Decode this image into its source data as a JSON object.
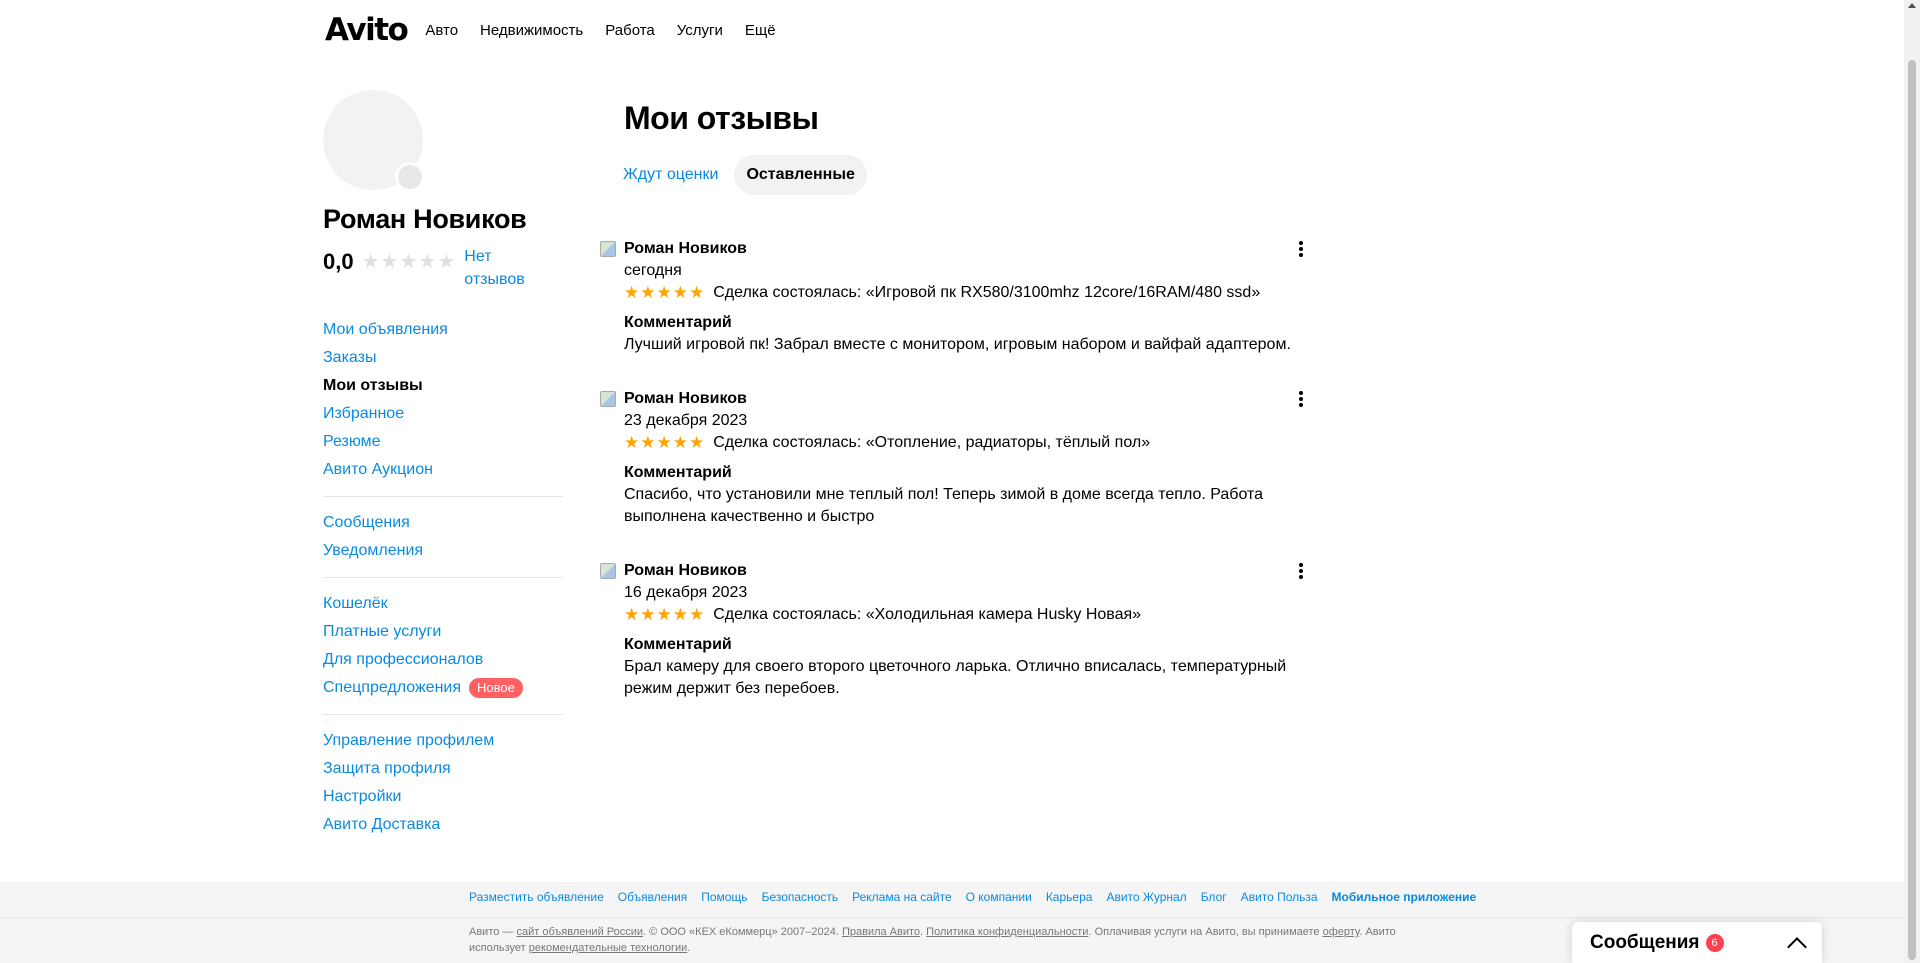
{
  "header": {
    "logo": "Avito",
    "nav": [
      "Авто",
      "Недвижимость",
      "Работа",
      "Услуги",
      "Ещё"
    ]
  },
  "profile": {
    "name": "Роман Новиков",
    "rating": "0,0",
    "rating_stars_filled": 0,
    "no_reviews": "Нет отзывов"
  },
  "sidebar": {
    "groups": [
      [
        {
          "label": "Мои объявления"
        },
        {
          "label": "Заказы"
        },
        {
          "label": "Мои отзывы",
          "active": true
        },
        {
          "label": "Избранное"
        },
        {
          "label": "Резюме"
        },
        {
          "label": "Авито Аукцион"
        }
      ],
      [
        {
          "label": "Сообщения"
        },
        {
          "label": "Уведомления"
        }
      ],
      [
        {
          "label": "Кошелёк"
        },
        {
          "label": "Платные услуги"
        },
        {
          "label": "Для профессионалов"
        },
        {
          "label": "Спецпредложения",
          "badge": "Новое"
        }
      ],
      [
        {
          "label": "Управление профилем"
        },
        {
          "label": "Защита профиля"
        },
        {
          "label": "Настройки"
        },
        {
          "label": "Авито Доставка"
        }
      ]
    ]
  },
  "main": {
    "title": "Мои отзывы",
    "tabs": [
      {
        "label": "Ждут оценки",
        "active": false
      },
      {
        "label": "Оставленные",
        "active": true
      }
    ],
    "reviews": [
      {
        "author": "Роман Новиков",
        "date": "сегодня",
        "stars": 5,
        "deal": "Сделка состоялась: «Игровой пк RX580/3100mhz 12core/16RAM/480 ssd»",
        "comment_title": "Комментарий",
        "comment": "Лучший игровой пк! Забрал вместе с монитором, игровым набором и вайфай адаптером."
      },
      {
        "author": "Роман Новиков",
        "date": "23 декабря 2023",
        "stars": 5,
        "deal": "Сделка состоялась: «Отопление, радиаторы, тёплый пол»",
        "comment_title": "Комментарий",
        "comment": "Спасибо, что установили мне теплый пол! Теперь зимой в доме всегда тепло. Работа выполнена качественно и быстро"
      },
      {
        "author": "Роман Новиков",
        "date": "16 декабря 2023",
        "stars": 5,
        "deal": "Сделка состоялась: «Холодильная камера Husky Новая»",
        "comment_title": "Комментарий",
        "comment": "Брал камеру для своего второго цветочного ларька. Отлично вписалась, температурный режим держит без перебоев."
      }
    ]
  },
  "footer": {
    "links": [
      {
        "label": "Разместить объявление"
      },
      {
        "label": "Объявления"
      },
      {
        "label": "Помощь"
      },
      {
        "label": "Безопасность"
      },
      {
        "label": "Реклама на сайте"
      },
      {
        "label": "О компании"
      },
      {
        "label": "Карьера"
      },
      {
        "label": "Авито Журнал"
      },
      {
        "label": "Блог"
      },
      {
        "label": "Авито Польза"
      },
      {
        "label": "Мобильное приложение",
        "strong": true
      }
    ],
    "legal": {
      "p1": "Авито — ",
      "l1": "сайт объявлений России",
      "p2": ". © ООО «КЕХ еКоммерц» 2007–2024. ",
      "l2": "Правила Авито",
      "p3": ". ",
      "l3": "Политика конфиденциальности",
      "p4": ". Оплачивая услуги на Авито, вы принимаете ",
      "l4": "оферту",
      "p5": ". Авито использует ",
      "l5": "рекомендательные технологии",
      "p6": "."
    }
  },
  "messenger": {
    "title": "Сообщения",
    "count": "6"
  },
  "colors": {
    "link": "#0a8adf",
    "star_active": "#ffa400",
    "star_inactive": "#e0e0e0",
    "badge": "#ff6163"
  },
  "icons": {
    "kebab": "more-vertical-icon",
    "chevron": "chevron-up-icon",
    "star": "star-icon"
  }
}
